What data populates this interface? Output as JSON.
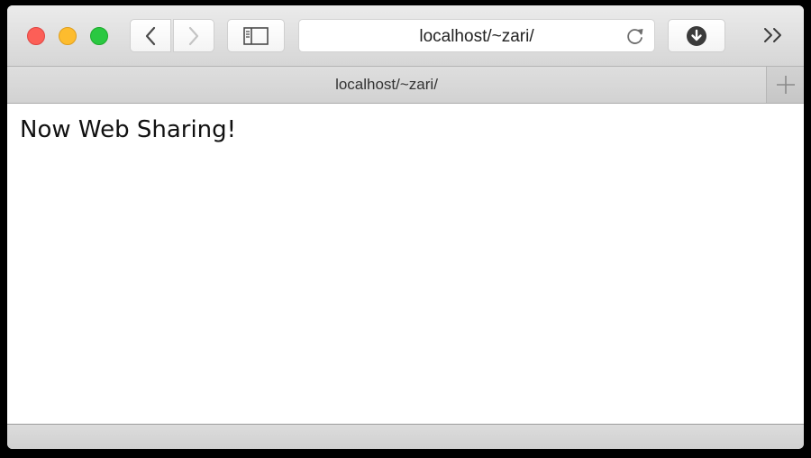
{
  "window": {
    "controls": [
      "close",
      "minimize",
      "zoom"
    ]
  },
  "toolbar": {
    "back_icon": "chevron-left-icon",
    "forward_icon": "chevron-right-icon",
    "sidebar_icon": "sidebar-icon",
    "address": "localhost/~zari/",
    "reload_icon": "reload-icon",
    "download_icon": "download-icon",
    "overflow_icon": "double-chevron-right-icon"
  },
  "tabs": [
    {
      "title": "localhost/~zari/"
    }
  ],
  "new_tab_icon": "plus-icon",
  "page": {
    "heading": "Now Web Sharing!"
  },
  "colors": {
    "close": "#fc5f57",
    "minimize": "#fdbc2e",
    "zoom": "#2ac841"
  }
}
